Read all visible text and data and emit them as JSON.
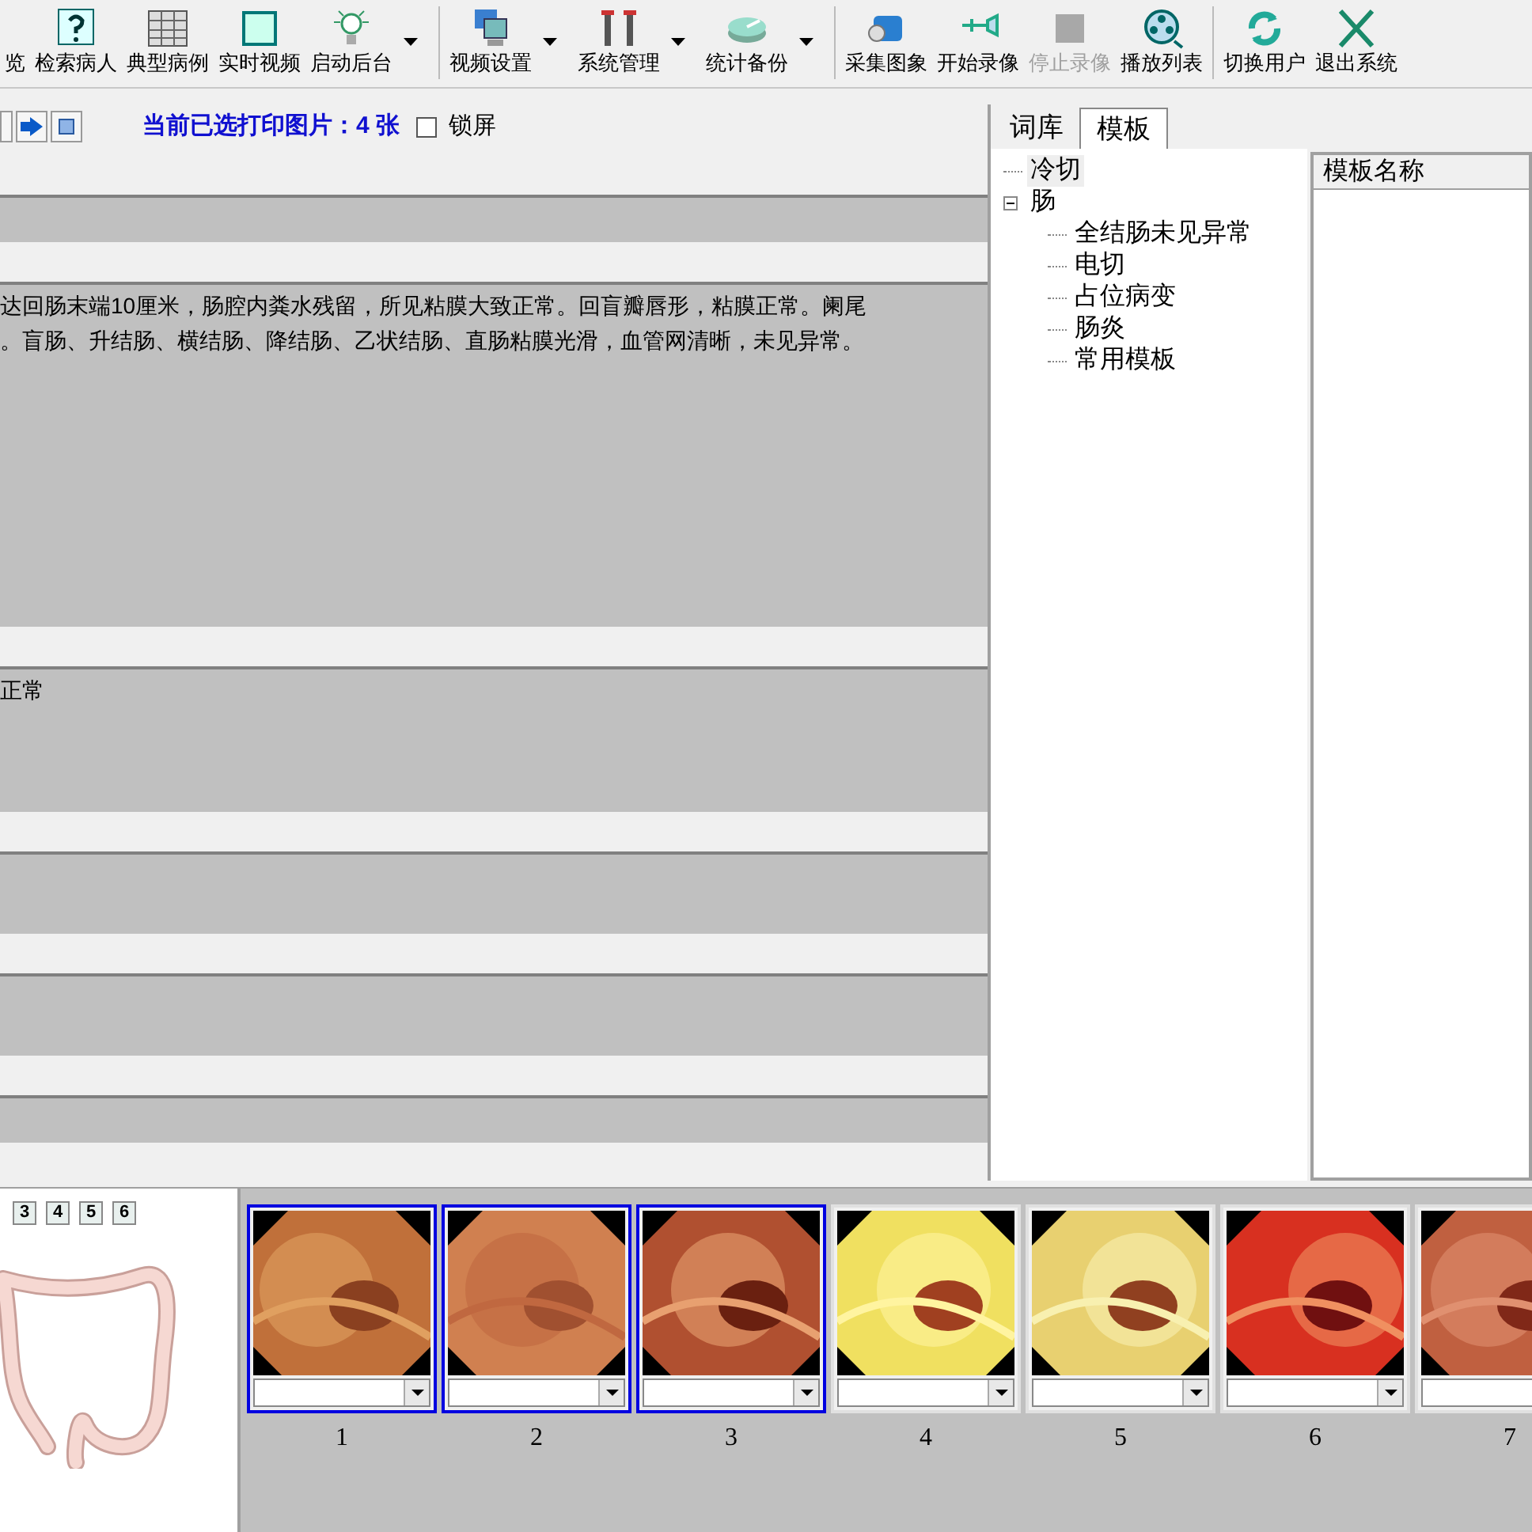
{
  "toolbar": [
    {
      "label": "览",
      "dropdown": false,
      "disabled": false
    },
    {
      "label": "检索病人",
      "dropdown": false,
      "disabled": false
    },
    {
      "label": "典型病例",
      "dropdown": false,
      "disabled": false
    },
    {
      "label": "实时视频",
      "dropdown": false,
      "disabled": false
    },
    {
      "label": "启动后台",
      "dropdown": true,
      "disabled": false
    },
    {
      "label": "视频设置",
      "dropdown": true,
      "disabled": false
    },
    {
      "label": "系统管理",
      "dropdown": true,
      "disabled": false
    },
    {
      "label": "统计备份",
      "dropdown": true,
      "disabled": false
    },
    {
      "label": "采集图象",
      "dropdown": false,
      "disabled": false
    },
    {
      "label": "开始录像",
      "dropdown": false,
      "disabled": false
    },
    {
      "label": "停止录像",
      "dropdown": false,
      "disabled": true
    },
    {
      "label": "播放列表",
      "dropdown": false,
      "disabled": false
    },
    {
      "label": "切换用户",
      "dropdown": false,
      "disabled": false
    },
    {
      "label": "退出系统",
      "dropdown": false,
      "disabled": false
    }
  ],
  "report": {
    "print_status": "当前已选打印图片：4 张",
    "lock_screen": {
      "label": "锁屏",
      "checked": false
    },
    "fields": [
      {
        "kind": "short"
      },
      {
        "kind": "tall",
        "lines": [
          "达回肠末端10厘米，肠腔内粪水残留，所见粘膜大致正常。回盲瓣唇形，粘膜正常。阑尾",
          "。盲肠、升结肠、横结肠、降结肠、乙状结肠、直肠粘膜光滑，血管网清晰，未见异常。"
        ]
      },
      {
        "kind": "medium",
        "lines": [
          "正常"
        ]
      },
      {
        "kind": "small"
      },
      {
        "kind": "small"
      },
      {
        "kind": "short"
      }
    ]
  },
  "library": {
    "tabs": [
      {
        "label": "词库",
        "selected": false
      },
      {
        "label": "模板",
        "selected": true
      }
    ],
    "tree": [
      {
        "label": "冷切",
        "selected": true
      },
      {
        "label": "肠",
        "expanded": true,
        "selected": false,
        "children": [
          {
            "label": "全结肠未见异常",
            "selected": false
          },
          {
            "label": "电切",
            "selected": false
          },
          {
            "label": "占位病变",
            "selected": false
          },
          {
            "label": "肠炎",
            "selected": false
          },
          {
            "label": "常用模板",
            "selected": false
          }
        ]
      }
    ],
    "list_column": "模板名称"
  },
  "colon_map": {
    "region_buttons": [
      "3",
      "4",
      "5",
      "6"
    ]
  },
  "thumbnails": [
    {
      "number": "1",
      "selected": true
    },
    {
      "number": "2",
      "selected": true
    },
    {
      "number": "3",
      "selected": true
    },
    {
      "number": "4",
      "selected": false
    },
    {
      "number": "5",
      "selected": false
    },
    {
      "number": "6",
      "selected": false
    },
    {
      "number": "7",
      "selected": false
    }
  ]
}
